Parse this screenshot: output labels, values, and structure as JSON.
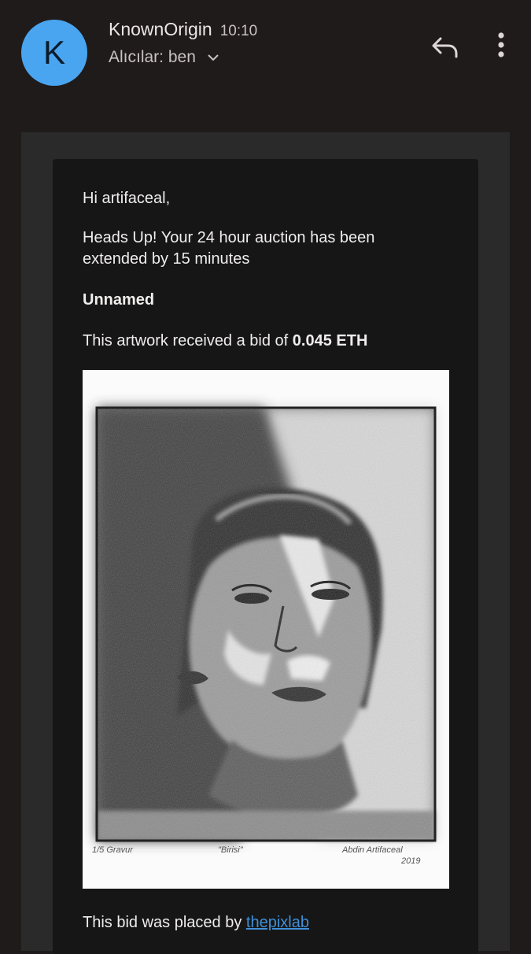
{
  "header": {
    "avatar_letter": "K",
    "sender": "KnownOrigin",
    "time": "10:10",
    "recipients": "Alıcılar: ben",
    "icons": [
      "reply-icon",
      "more-vert-icon",
      "chevron-down-icon"
    ]
  },
  "email": {
    "greeting": "Hi artifaceal,",
    "headsup": "Heads Up! Your 24 hour auction has been extended by 15 minutes",
    "artwork_title": "Unnamed",
    "bid_prefix": "This artwork received a bid of ",
    "bid_amount": "0.045 ETH",
    "artwork_caption_left": "1/5 Gravur",
    "artwork_caption_mid": "\"Birisi\"",
    "artwork_caption_right": "Abdin Artifaceal",
    "artwork_caption_year": "2019",
    "placed_prefix": "This bid was placed by ",
    "bidder": "thepixlab"
  },
  "colors": {
    "background": "#1f1b1b",
    "avatar": "#4aa5f0",
    "link": "#3f8fd8",
    "card": "#161616"
  }
}
